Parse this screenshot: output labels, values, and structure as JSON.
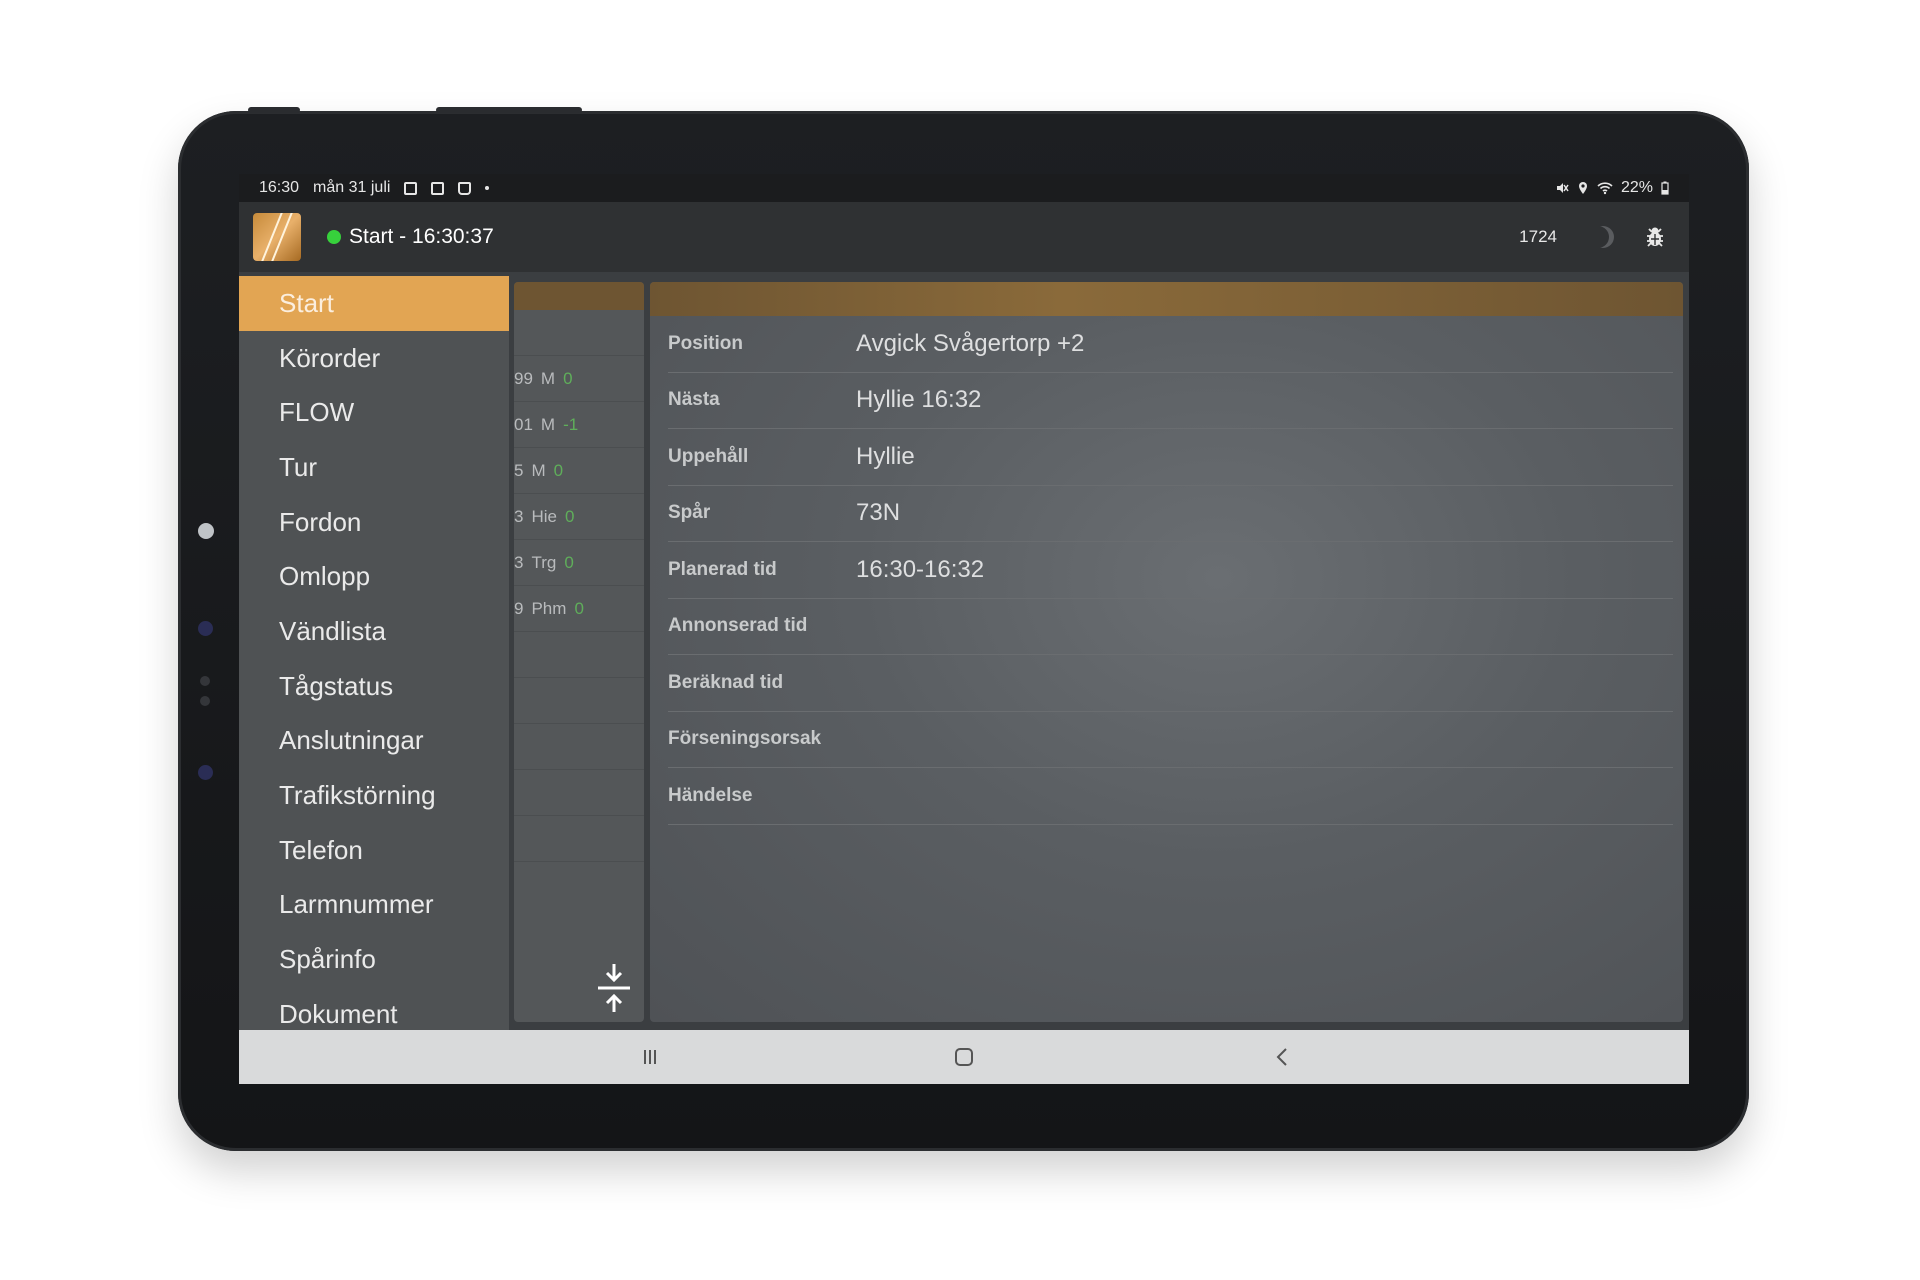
{
  "status_bar": {
    "time": "16:30",
    "date": "mån 31 juli",
    "battery": "22%"
  },
  "app_bar": {
    "title": "Start - 16:30:37",
    "counter": "1724",
    "connection_color": "#37d13c"
  },
  "drawer": {
    "items": [
      {
        "label": "Start"
      },
      {
        "label": "Körorder"
      },
      {
        "label": "FLOW"
      },
      {
        "label": "Tur"
      },
      {
        "label": "Fordon"
      },
      {
        "label": "Omlopp"
      },
      {
        "label": "Vändlista"
      },
      {
        "label": "Tågstatus"
      },
      {
        "label": "Anslutningar"
      },
      {
        "label": "Trafikstörning"
      },
      {
        "label": "Telefon"
      },
      {
        "label": "Larmnummer"
      },
      {
        "label": "Spårinfo"
      },
      {
        "label": "Dokument"
      }
    ],
    "active_color": "#e2a553"
  },
  "middle_list": {
    "rows": [
      {
        "id": "",
        "code": "",
        "delay": ""
      },
      {
        "id": "99",
        "code": "M",
        "delay": "0"
      },
      {
        "id": "01",
        "code": "M",
        "delay": "-1"
      },
      {
        "id": "5",
        "code": "M",
        "delay": "0"
      },
      {
        "id": "3",
        "code": "Hie",
        "delay": "0"
      },
      {
        "id": "3",
        "code": "Trg",
        "delay": "0"
      },
      {
        "id": "9",
        "code": "Phm",
        "delay": "0"
      },
      {
        "id": "",
        "code": "",
        "delay": ""
      },
      {
        "id": "",
        "code": "",
        "delay": ""
      },
      {
        "id": "",
        "code": "",
        "delay": ""
      },
      {
        "id": "",
        "code": "",
        "delay": ""
      },
      {
        "id": "",
        "code": "",
        "delay": ""
      }
    ]
  },
  "details": {
    "rows": [
      {
        "label": "Position",
        "value": "Avgick Svågertorp +2"
      },
      {
        "label": "Nästa",
        "value": "Hyllie 16:32"
      },
      {
        "label": "Uppehåll",
        "value": "Hyllie"
      },
      {
        "label": "Spår",
        "value": "73N"
      },
      {
        "label": "Planerad tid",
        "value": "16:30-16:32"
      },
      {
        "label": "Annonserad tid",
        "value": ""
      },
      {
        "label": "Beräknad tid",
        "value": ""
      },
      {
        "label": "Förseningsorsak",
        "value": ""
      },
      {
        "label": "Händelse",
        "value": ""
      }
    ]
  }
}
